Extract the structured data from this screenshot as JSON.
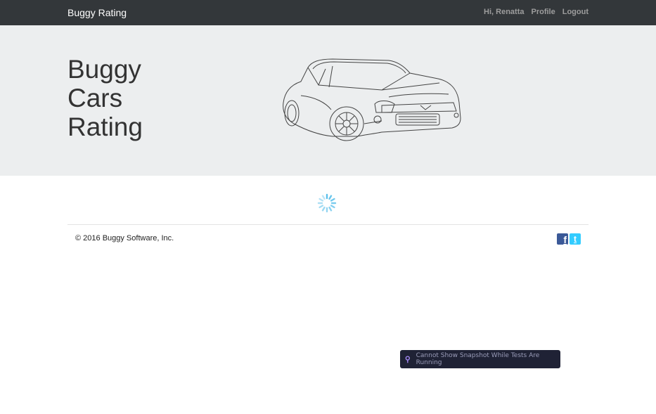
{
  "navbar": {
    "brand": "Buggy Rating",
    "greeting": "Hi, Renatta",
    "profile": "Profile",
    "logout": "Logout"
  },
  "hero": {
    "title": "Buggy Cars Rating",
    "image": "car-line-drawing"
  },
  "footer": {
    "copyright": "© 2016 Buggy Software, Inc.",
    "social": [
      "facebook-icon",
      "twitter-icon"
    ]
  },
  "toast": {
    "text": "Cannot Show Snapshot While Tests Are Running",
    "icon": "pin-icon"
  },
  "colors": {
    "navbar_bg": "#33373a",
    "jumbotron_bg": "#eceeef",
    "spinner": "#5bc0eb",
    "toast_bg": "#1f2235",
    "pin": "#a78bfa"
  }
}
